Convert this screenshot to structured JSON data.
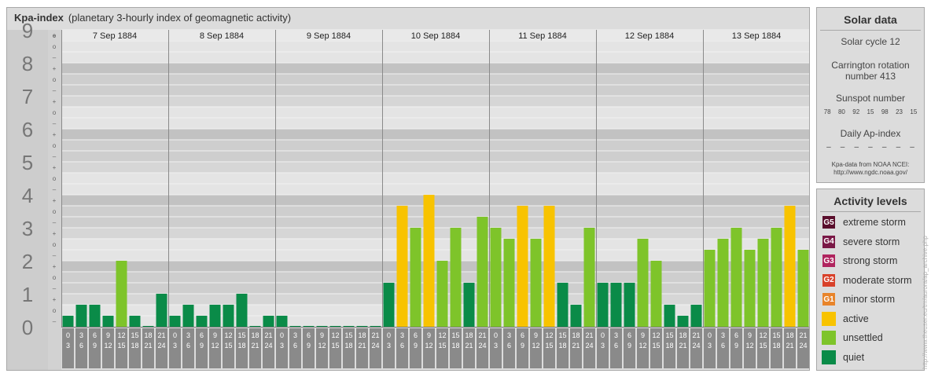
{
  "header": {
    "title": "Kpa-index",
    "subtitle": "(planetary 3-hourly index of geomagnetic activity)"
  },
  "chart_data": {
    "type": "bar",
    "title": "Kpa-index",
    "subtitle": "(planetary 3-hourly index of geomagnetic activity)",
    "ylim": [
      0,
      9
    ],
    "y_ticks": [
      "0",
      "1",
      "2",
      "3",
      "4",
      "5",
      "6",
      "7",
      "8",
      "9"
    ],
    "sub_ticks": [
      "–",
      "o",
      "+"
    ],
    "days": [
      "7 Sep 1884",
      "8 Sep 1884",
      "9 Sep 1884",
      "10 Sep 1884",
      "11 Sep 1884",
      "12 Sep 1884",
      "13 Sep 1884"
    ],
    "interval_start": [
      "0",
      "3",
      "6",
      "9",
      "12",
      "15",
      "18",
      "21"
    ],
    "interval_end": [
      "3",
      "6",
      "9",
      "12",
      "15",
      "18",
      "21",
      "24"
    ],
    "values": [
      [
        0.333,
        0.667,
        0.667,
        0.333,
        2.0,
        0.333,
        0.0,
        1.0
      ],
      [
        0.333,
        0.667,
        0.333,
        0.667,
        0.667,
        1.0,
        0.0,
        0.333
      ],
      [
        0.333,
        0.0,
        0.0,
        0.0,
        0.0,
        0.0,
        0.0,
        0.0
      ],
      [
        1.333,
        3.667,
        3.0,
        4.0,
        2.0,
        3.0,
        1.333,
        3.333
      ],
      [
        3.0,
        2.667,
        3.667,
        2.667,
        3.667,
        1.333,
        0.667,
        3.0
      ],
      [
        1.333,
        1.333,
        1.333,
        2.667,
        2.0,
        0.667,
        0.333,
        0.667
      ],
      [
        2.333,
        2.667,
        3.0,
        2.333,
        2.667,
        3.0,
        3.667,
        2.333
      ]
    ],
    "levels": [
      {
        "name": "quiet",
        "color": "#0a8b48"
      },
      {
        "name": "unsettled",
        "color": "#7ec42a"
      },
      {
        "name": "active",
        "color": "#f8c300"
      }
    ]
  },
  "solar": {
    "heading": "Solar data",
    "cycle": "Solar cycle 12",
    "carrington_line1": "Carrington rotation",
    "carrington_line2": "number 413",
    "sunspot_label": "Sunspot number",
    "sunspot_values": [
      "78",
      "80",
      "92",
      "15",
      "98",
      "23",
      "15"
    ],
    "ap_label": "Daily Ap-index",
    "ap_values": [
      "–",
      "–",
      "–",
      "–",
      "–",
      "–",
      "–"
    ],
    "source_line1": "Kpa-data from NOAA NCEI:",
    "source_line2": "http://www.ngdc.noaa.gov/"
  },
  "activity": {
    "heading": "Activity levels",
    "items": [
      {
        "badge": "G5",
        "label": "extreme storm",
        "color": "#5a0e2c"
      },
      {
        "badge": "G4",
        "label": "severe storm",
        "color": "#7a1846"
      },
      {
        "badge": "G3",
        "label": "strong storm",
        "color": "#b0245e"
      },
      {
        "badge": "G2",
        "label": "moderate storm",
        "color": "#d8412a"
      },
      {
        "badge": "G1",
        "label": "minor storm",
        "color": "#e8842a"
      },
      {
        "badge": "",
        "label": "active",
        "color": "#f8c300"
      },
      {
        "badge": "",
        "label": "unsettled",
        "color": "#7ec42a"
      },
      {
        "badge": "",
        "label": "quiet",
        "color": "#0a8b48"
      }
    ]
  },
  "watermark": "http://www.theuser.eu/tm/aurora/ap_archive.php"
}
